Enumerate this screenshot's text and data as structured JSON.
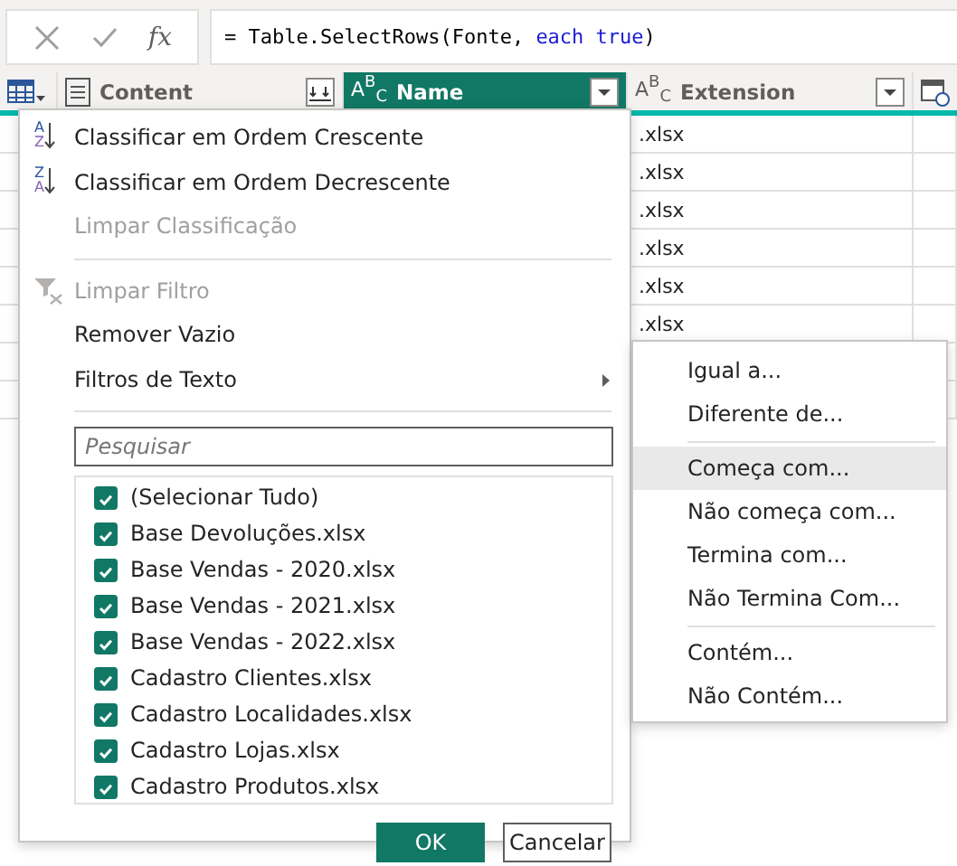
{
  "formula_bar": {
    "fx_label": "fx",
    "formula": [
      {
        "text": "= Table.SelectRows(Fonte, ",
        "kind": "plain"
      },
      {
        "text": "each true",
        "kind": "keyword"
      },
      {
        "text": ")",
        "kind": "plain"
      }
    ]
  },
  "columns": [
    {
      "label": "Content",
      "selected": false
    },
    {
      "label": "Name",
      "type_label": "A$^{B}$$_{C}$",
      "selected": true
    },
    {
      "label": "Extension",
      "type_label": "A$^{B}$$_{C}$",
      "selected": false
    }
  ],
  "rows": [
    {
      "extension": ".xlsx"
    },
    {
      "extension": ".xlsx"
    },
    {
      "extension": ".xlsx"
    },
    {
      "extension": ".xlsx"
    },
    {
      "extension": ".xlsx"
    },
    {
      "extension": ".xlsx"
    }
  ],
  "menu": {
    "groups": [
      [
        {
          "label": "Classificar em Ordem Crescente",
          "icon_letters": [
            "A",
            "Z"
          ],
          "disabled": false
        },
        {
          "label": "Classificar em Ordem Decrescente",
          "icon_letters": [
            "Z",
            "A"
          ],
          "disabled": false
        },
        {
          "label": "Limpar Classificação",
          "disabled": true
        }
      ],
      [
        {
          "label": "Limpar Filtro",
          "disabled": true
        },
        {
          "label": "Remover Vazio",
          "disabled": false
        },
        {
          "label": "Filtros de Texto",
          "disabled": false,
          "submenu": true
        }
      ]
    ],
    "search": {
      "placeholder": "Pesquisar"
    },
    "values": [
      {
        "label": "(Selecionar Tudo)",
        "checked": true
      },
      {
        "label": "Base Devoluções.xlsx",
        "checked": true
      },
      {
        "label": "Base Vendas - 2020.xlsx",
        "checked": true
      },
      {
        "label": "Base Vendas - 2021.xlsx",
        "checked": true
      },
      {
        "label": "Base Vendas - 2022.xlsx",
        "checked": true
      },
      {
        "label": "Cadastro Clientes.xlsx",
        "checked": true
      },
      {
        "label": "Cadastro Localidades.xlsx",
        "checked": true
      },
      {
        "label": "Cadastro Lojas.xlsx",
        "checked": true
      },
      {
        "label": "Cadastro Produtos.xlsx",
        "checked": true
      }
    ],
    "buttons": [
      {
        "label": "OK",
        "kind": "primary"
      },
      {
        "label": "Cancelar",
        "kind": "secondary"
      }
    ]
  },
  "submenu": {
    "groups": [
      [
        {
          "label": "Igual a...",
          "selected": false
        },
        {
          "label": "Diferente de...",
          "selected": false
        }
      ],
      [
        {
          "label": "Começa com...",
          "selected": true
        },
        {
          "label": "Não começa com...",
          "selected": false
        },
        {
          "label": "Termina com...",
          "selected": false
        },
        {
          "label": "Não Termina Com...",
          "selected": false
        }
      ],
      [
        {
          "label": "Contém...",
          "selected": false
        },
        {
          "label": "Não Contém...",
          "selected": false
        }
      ]
    ]
  }
}
